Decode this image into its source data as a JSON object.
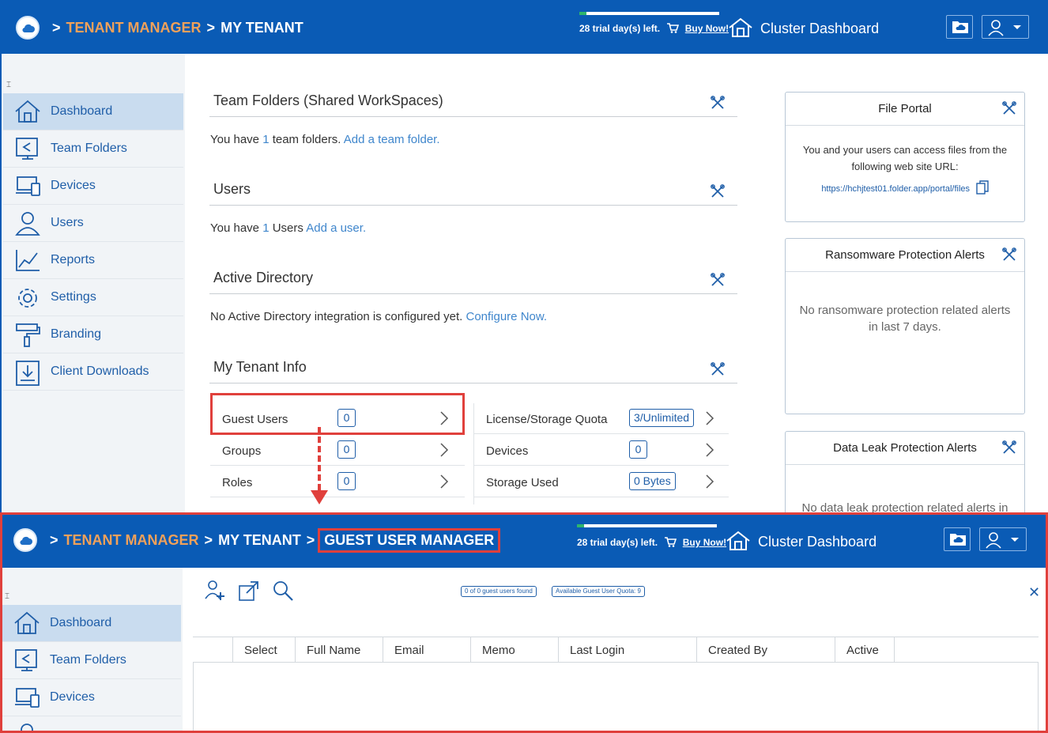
{
  "breadcrumb": {
    "sep": ">",
    "tenant_manager": "TENANT MANAGER",
    "my_tenant": "MY TENANT",
    "guest_user_manager": "GUEST USER MANAGER"
  },
  "header": {
    "trial_text": "28 trial day(s) left.",
    "trial_progress": 0.05,
    "buy_now": "Buy Now!",
    "cluster_dashboard": "Cluster Dashboard"
  },
  "sidebar": {
    "items": [
      {
        "label": "Dashboard",
        "icon": "home-icon"
      },
      {
        "label": "Team Folders",
        "icon": "share-folder-icon"
      },
      {
        "label": "Devices",
        "icon": "devices-icon"
      },
      {
        "label": "Users",
        "icon": "user-icon"
      },
      {
        "label": "Reports",
        "icon": "chart-icon"
      },
      {
        "label": "Settings",
        "icon": "gear-icon"
      },
      {
        "label": "Branding",
        "icon": "paint-roller-icon"
      },
      {
        "label": "Client Downloads",
        "icon": "download-icon"
      }
    ]
  },
  "team_folders": {
    "title": "Team Folders (Shared WorkSpaces)",
    "text_before": "You have ",
    "count": "1",
    "text_after": " team folders. ",
    "link": "Add a team folder."
  },
  "users": {
    "title": "Users",
    "text_before": "You have ",
    "count": "1",
    "text_after": " Users ",
    "link": "Add a user."
  },
  "active_directory": {
    "title": "Active Directory",
    "text": "No Active Directory integration is configured yet. ",
    "link": "Configure Now."
  },
  "tenant_info": {
    "title": "My Tenant Info",
    "left": [
      {
        "label": "Guest Users",
        "value": "0"
      },
      {
        "label": "Groups",
        "value": "0"
      },
      {
        "label": "Roles",
        "value": "0"
      }
    ],
    "right": [
      {
        "label": "License/Storage Quota",
        "value": "3/Unlimited"
      },
      {
        "label": "Devices",
        "value": "0"
      },
      {
        "label": "Storage Used",
        "value": "0 Bytes"
      }
    ]
  },
  "file_portal": {
    "title": "File Portal",
    "text": "You and your users can access files from the following web site URL:",
    "url": "https://hchjtest01.folder.app/portal/files"
  },
  "ransomware": {
    "title": "Ransomware Protection Alerts",
    "text": "No ransomware protection related alerts in last 7 days."
  },
  "data_leak": {
    "title": "Data Leak Protection Alerts",
    "text": "No data leak protection related alerts in"
  },
  "guest_manager": {
    "found": "0 of 0 guest users found",
    "quota": "Available Guest User Quota: 9",
    "columns": [
      "Select",
      "Full Name",
      "Email",
      "Memo",
      "Last Login",
      "Created By",
      "Active"
    ],
    "sidebar_items": [
      "Dashboard",
      "Team Folders",
      "Devices"
    ]
  }
}
